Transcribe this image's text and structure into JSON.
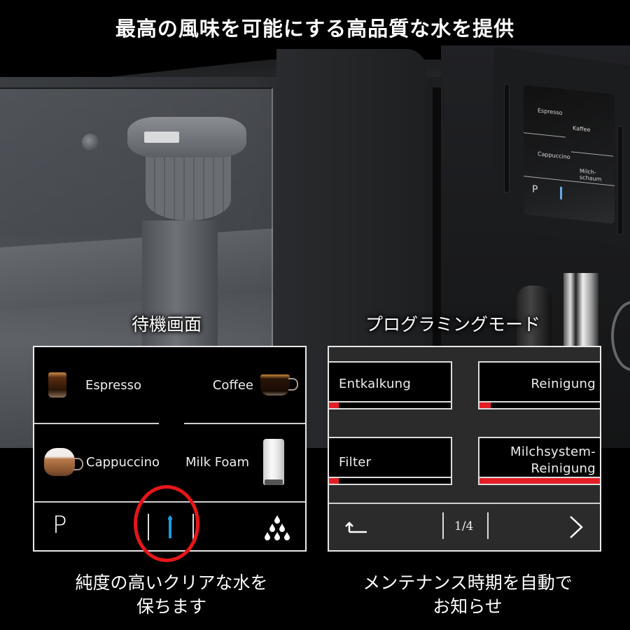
{
  "headline": "最高の風味を可能にする高品質な水を提供",
  "machine_display": {
    "items": [
      "Espresso",
      "Kaffee",
      "Cappuccino",
      "Milch-\nschaum"
    ],
    "p_label": "P"
  },
  "standby_screen": {
    "section_label": "待機画面",
    "products": [
      {
        "label": "Espresso",
        "icon": "espresso-cup-icon"
      },
      {
        "label": "Coffee",
        "icon": "coffee-cup-icon"
      },
      {
        "label": "Cappuccino",
        "icon": "cappuccino-cup-icon"
      },
      {
        "label": "Milk Foam",
        "icon": "milk-foam-glass-icon"
      }
    ],
    "bottom_bar": {
      "p_label": "P",
      "center_icon": "water-filter-icon",
      "center_icon_color": "#1e9be0",
      "right_icon": "water-drops-icon"
    },
    "highlight_color": "#e5161a",
    "caption": [
      "純度の高いクリアな水を",
      "保ちます"
    ]
  },
  "programming_mode": {
    "section_label": "プログラミングモード",
    "tiles": [
      {
        "label": "Entkalkung",
        "progress": 0.08
      },
      {
        "label": "Reinigung",
        "progress": 0.09
      },
      {
        "label": "Filter",
        "progress": 0.08
      },
      {
        "label": "Milchsystem-\nReinigung",
        "progress": 1.0
      }
    ],
    "progress_color": "#e31e24",
    "nav": {
      "back_icon": "back-arrow-icon",
      "page": "1/4",
      "next_icon": "chevron-right-icon"
    },
    "caption": [
      "メンテナンス時期を自動で",
      "お知らせ"
    ]
  }
}
